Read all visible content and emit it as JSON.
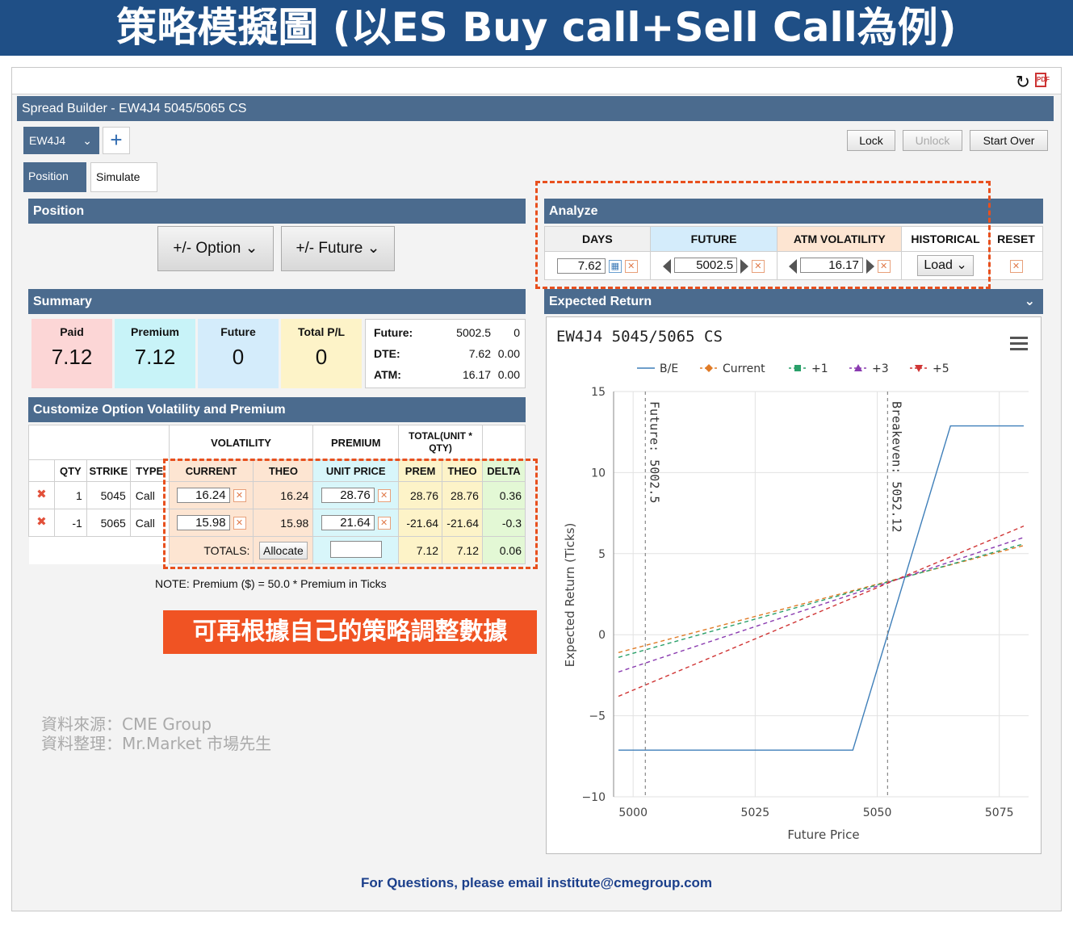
{
  "banner": {
    "title": "策略模擬圖 (以ES Buy call+Sell Call為例)"
  },
  "window": {
    "title": "Spread Builder - EW4J4 5045/5065 CS"
  },
  "toolbar": {
    "instrument_tab": "EW4J4",
    "lock": "Lock",
    "unlock": "Unlock",
    "start_over": "Start Over"
  },
  "subtabs": [
    "Position",
    "Simulate"
  ],
  "position": {
    "header": "Position",
    "option_btn": "+/- Option",
    "future_btn": "+/- Future"
  },
  "summary": {
    "header": "Summary",
    "cards": [
      {
        "label": "Paid",
        "value": "7.12",
        "color": "#fcd6d6"
      },
      {
        "label": "Premium",
        "value": "7.12",
        "color": "#c8f3f8"
      },
      {
        "label": "Future",
        "value": "0",
        "color": "#d4ecfb"
      },
      {
        "label": "Total P/L",
        "value": "0",
        "color": "#fdf3c8"
      }
    ],
    "info": [
      {
        "key": "Future:",
        "v1": "5002.5",
        "v2": "0"
      },
      {
        "key": "DTE:",
        "v1": "7.62",
        "v2": "0.00"
      },
      {
        "key": "ATM:",
        "v1": "16.17",
        "v2": "0.00"
      }
    ]
  },
  "customize": {
    "header": "Customize Option Volatility and Premium",
    "group_headers": {
      "volatility": "VOLATILITY",
      "premium": "PREMIUM",
      "total": "TOTAL(UNIT * QTY)"
    },
    "columns": [
      "QTY",
      "STRIKE",
      "TYPE",
      "CURRENT",
      "THEO",
      "UNIT PRICE",
      "PREM",
      "THEO",
      "DELTA"
    ],
    "rows": [
      {
        "qty": "1",
        "strike": "5045",
        "type": "Call",
        "current": "16.24",
        "theo": "16.24",
        "unit_price": "28.76",
        "prem": "28.76",
        "total_theo": "28.76",
        "delta": "0.36"
      },
      {
        "qty": "-1",
        "strike": "5065",
        "type": "Call",
        "current": "15.98",
        "theo": "15.98",
        "unit_price": "21.64",
        "prem": "-21.64",
        "total_theo": "-21.64",
        "delta": "-0.3"
      }
    ],
    "totals_label": "TOTALS:",
    "allocate": "Allocate",
    "totals": {
      "prem": "7.12",
      "theo": "7.12",
      "delta": "0.06"
    },
    "note": "NOTE: Premium ($) = 50.0 * Premium in Ticks"
  },
  "callout": "可再根據自己的策略調整數據",
  "source": {
    "line1": "資料來源：CME Group",
    "line2": "資料整理：Mr.Market 市場先生"
  },
  "analyze": {
    "header": "Analyze",
    "columns": [
      "DAYS",
      "FUTURE",
      "ATM VOLATILITY",
      "HISTORICAL",
      "RESET"
    ],
    "days": "7.62",
    "future": "5002.5",
    "atm_vol": "16.17",
    "load": "Load"
  },
  "expected": {
    "header": "Expected Return"
  },
  "chart_data": {
    "type": "line",
    "title": "EW4J4 5045/5065 CS",
    "xlabel": "Future Price",
    "ylabel": "Expected Return (Ticks)",
    "xlim": [
      4996,
      5081
    ],
    "ylim": [
      -10,
      15
    ],
    "xticks": [
      "5000",
      "5025",
      "5050",
      "5075"
    ],
    "yticks": [
      "15",
      "10",
      "5",
      "0",
      "−5",
      "−10"
    ],
    "annotations": [
      {
        "text": "Future: 5002.5",
        "x": 5002.5
      },
      {
        "text": "Breakeven: 5052.12",
        "x": 5052.12
      }
    ],
    "series": [
      {
        "name": "B/E",
        "color": "#3f7fb9",
        "dash": "",
        "x": [
          4997,
          5045,
          5065,
          5080
        ],
        "y": [
          -7.12,
          -7.12,
          12.88,
          12.88
        ]
      },
      {
        "name": "Current",
        "color": "#e07b27",
        "dash": "5,4",
        "x": [
          4997,
          5080
        ],
        "y": [
          -1.1,
          5.5
        ]
      },
      {
        "name": "+1",
        "color": "#2aa06a",
        "dash": "5,4",
        "x": [
          4997,
          5080
        ],
        "y": [
          -1.4,
          5.6
        ]
      },
      {
        "name": "+3",
        "color": "#8a3bb0",
        "dash": "5,4",
        "x": [
          4997,
          5080
        ],
        "y": [
          -2.3,
          6.0
        ]
      },
      {
        "name": "+5",
        "color": "#d03535",
        "dash": "5,4",
        "x": [
          4997,
          5080
        ],
        "y": [
          -3.8,
          6.7
        ]
      }
    ],
    "legend_position": "top"
  },
  "footer": "For Questions, please email institute@cmegroup.com"
}
